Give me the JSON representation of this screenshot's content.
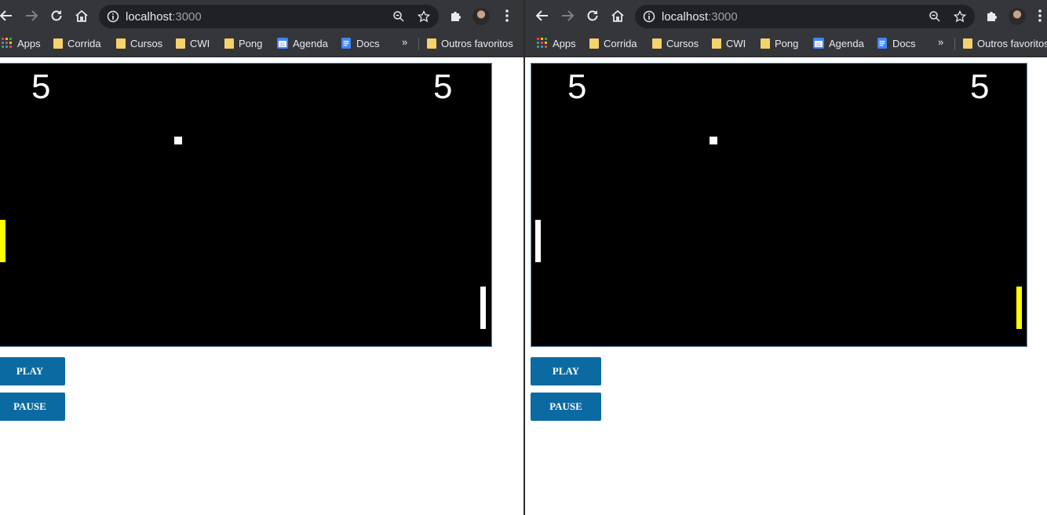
{
  "colors": {
    "chrome_bg": "#35363a",
    "omnibox_bg": "#202124",
    "game_bg": "#000000",
    "active_paddle": "#ffff00",
    "idle_paddle": "#ffffff",
    "button_bg": "#0b6aa2"
  },
  "icons": {
    "back": "arrow-left",
    "forward": "arrow-right",
    "reload": "reload",
    "home": "home",
    "site_info": "info-circle",
    "zoom": "zoom-magnifier",
    "star": "star-outline",
    "extensions": "puzzle-piece",
    "menu": "kebab-menu"
  },
  "address": {
    "host": "localhost",
    "port": ":3000"
  },
  "bookmarks": [
    "Apps",
    "Corrida",
    "Cursos",
    "CWI",
    "Pong",
    "Agenda",
    "Docs"
  ],
  "bookmarks_more": "»",
  "other_bookmarks": "Outros favoritos",
  "windows": [
    {
      "scores": {
        "left": "5",
        "right": "5"
      },
      "active_paddle": "left",
      "buttons": {
        "play": "PLAY",
        "pause": "PAUSE"
      }
    },
    {
      "scores": {
        "left": "5",
        "right": "5"
      },
      "active_paddle": "right",
      "buttons": {
        "play": "PLAY",
        "pause": "PAUSE"
      }
    }
  ]
}
